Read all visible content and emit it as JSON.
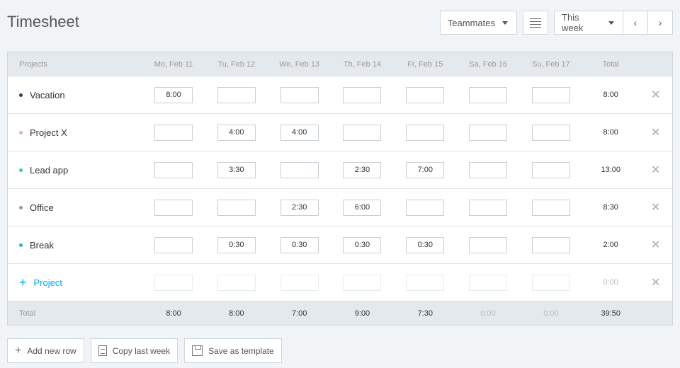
{
  "header": {
    "title": "Timesheet",
    "teammates_label": "Teammates",
    "week_label": "This week",
    "prev_label": "‹",
    "next_label": "›"
  },
  "table": {
    "projects_header": "Projects",
    "days": [
      "Mo, Feb 11",
      "Tu, Feb 12",
      "We, Feb 13",
      "Th, Feb 14",
      "Fr, Feb 15",
      "Sa, Feb 16",
      "Su, Feb 17"
    ],
    "total_header": "Total",
    "rows": [
      {
        "name": "Vacation",
        "color": "#2c3e6b",
        "values": [
          "8:00",
          "",
          "",
          "",
          "",
          "",
          ""
        ],
        "total": "8:00"
      },
      {
        "name": "Project X",
        "color": "#e6a4d8",
        "values": [
          "",
          "4:00",
          "4:00",
          "",
          "",
          "",
          ""
        ],
        "total": "8:00"
      },
      {
        "name": "Lead app",
        "color": "#3cc8b4",
        "values": [
          "",
          "3:30",
          "",
          "2:30",
          "7:00",
          "",
          ""
        ],
        "total": "13:00"
      },
      {
        "name": "Office",
        "color": "#999999",
        "values": [
          "",
          "",
          "2:30",
          "6:00",
          "",
          "",
          ""
        ],
        "total": "8:30"
      },
      {
        "name": "Break",
        "color": "#2bb5c8",
        "values": [
          "",
          "0:30",
          "0:30",
          "0:30",
          "0:30",
          "",
          ""
        ],
        "total": "2:00"
      }
    ],
    "add_project_label": "Project",
    "add_project_total": "0:00",
    "footer": {
      "label": "Total",
      "values": [
        "8:00",
        "8:00",
        "7:00",
        "9:00",
        "7:30",
        "0:00",
        "0:00"
      ],
      "total": "39:50"
    }
  },
  "actions": {
    "add_row_label": "Add new row",
    "copy_label": "Copy last week",
    "template_label": "Save as template"
  }
}
